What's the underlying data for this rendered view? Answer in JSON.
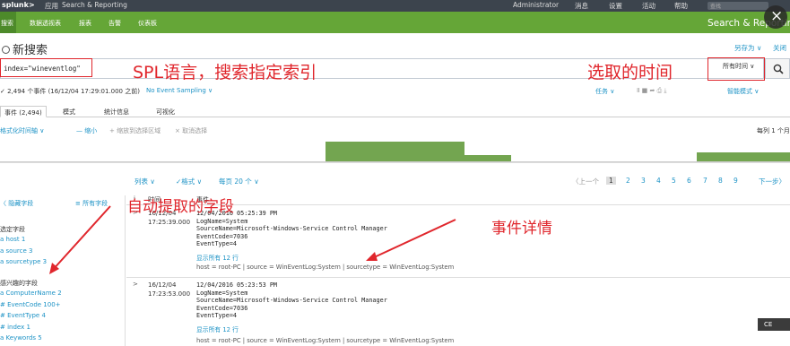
{
  "topbar": {
    "logo": "splunk>",
    "app_menu": "应用",
    "app_name": "Search & Reporting",
    "user": "Administrator",
    "messages": "消息",
    "settings": "设置",
    "activity": "活动",
    "help": "帮助",
    "find_placeholder": "查找"
  },
  "appbar": {
    "nav": [
      "搜索",
      "数据透视表",
      "报表",
      "告警",
      "仪表板"
    ],
    "app_title": "Search & Reporting"
  },
  "page": {
    "title": "新搜索",
    "save_as": "另存为 ∨",
    "close": "关闭"
  },
  "search": {
    "query": "index=\"wineventlog\"",
    "time_range": "所有时间 ∨"
  },
  "annotations": {
    "spl_note": "SPL语言，搜索指定索引",
    "time_note": "选取的时间",
    "fields_note": "自动提取的字段",
    "event_note": "事件详情"
  },
  "status": {
    "summary": "✓ 2,494 个事件 (16/12/04 17:29:01.000 之前)",
    "sampling": "No Event Sampling ∨",
    "job": "任务 ∨",
    "mode": "智能模式 ∨"
  },
  "tabs": [
    "事件 (2,494)",
    "模式",
    "统计信息",
    "可视化"
  ],
  "timeline": {
    "format": "格式化时间轴 ∨",
    "zoom_out": "— 缩小",
    "zoom_selection": "+ 缩放到选择区域",
    "deselect": "× 取消选择",
    "scale": "每列 1 个月"
  },
  "list": {
    "list": "列表 ∨",
    "format": "✓格式 ∨",
    "per_page": "每页 20 个 ∨",
    "prev": "〈上一个",
    "pages": [
      "1",
      "2",
      "3",
      "4",
      "5",
      "6",
      "7",
      "8",
      "9"
    ],
    "next": "下一步〉"
  },
  "sidebar": {
    "hide_fields": "〈 隐藏字段",
    "all_fields": "≡ 所有字段",
    "selected_header": "选定字段",
    "selected": [
      "a host 1",
      "a source 3",
      "a sourcetype 3"
    ],
    "interesting_header": "感兴趣的字段",
    "interesting": [
      "a ComputerName 2",
      "# EventCode 100+",
      "# EventType 4",
      "# index 1",
      "a Keywords 5"
    ]
  },
  "events_header": {
    "i": "i",
    "time": "时间",
    "event": "事件"
  },
  "events": [
    {
      "arrow": ">",
      "date": "16/12/04",
      "time": "17:25:39.000",
      "body": "12/04/2016 05:25:39 PM\nLogName=System\nSourceName=Microsoft-Windows-Service Control Manager\nEventCode=7036\nEventType=4",
      "more": "显示所有 12 行",
      "meta": "host = root-PC   |   source = WinEventLog:System   |   sourcetype = WinEventLog:System"
    },
    {
      "arrow": ">",
      "date": "16/12/04",
      "time": "17:23:53.000",
      "body": "12/04/2016 05:23:53 PM\nLogName=System\nSourceName=Microsoft-Windows-Service Control Manager\nEventCode=7036\nEventType=4",
      "more": "显示所有 12 行",
      "meta": "host = root-PC   |   source = WinEventLog:System   |   sourcetype = WinEventLog:System"
    }
  ],
  "histogram_levels": [
    0,
    0,
    0,
    0,
    0,
    0,
    0,
    0.95,
    0.95,
    0.95,
    0.3,
    0,
    0,
    0,
    0,
    0.45,
    0.45
  ],
  "colors": {
    "brand_green": "#65a637",
    "bar_green": "#73a550",
    "annotation_red": "#e0262c",
    "link_blue": "#1e93c6"
  },
  "badge": "CE"
}
